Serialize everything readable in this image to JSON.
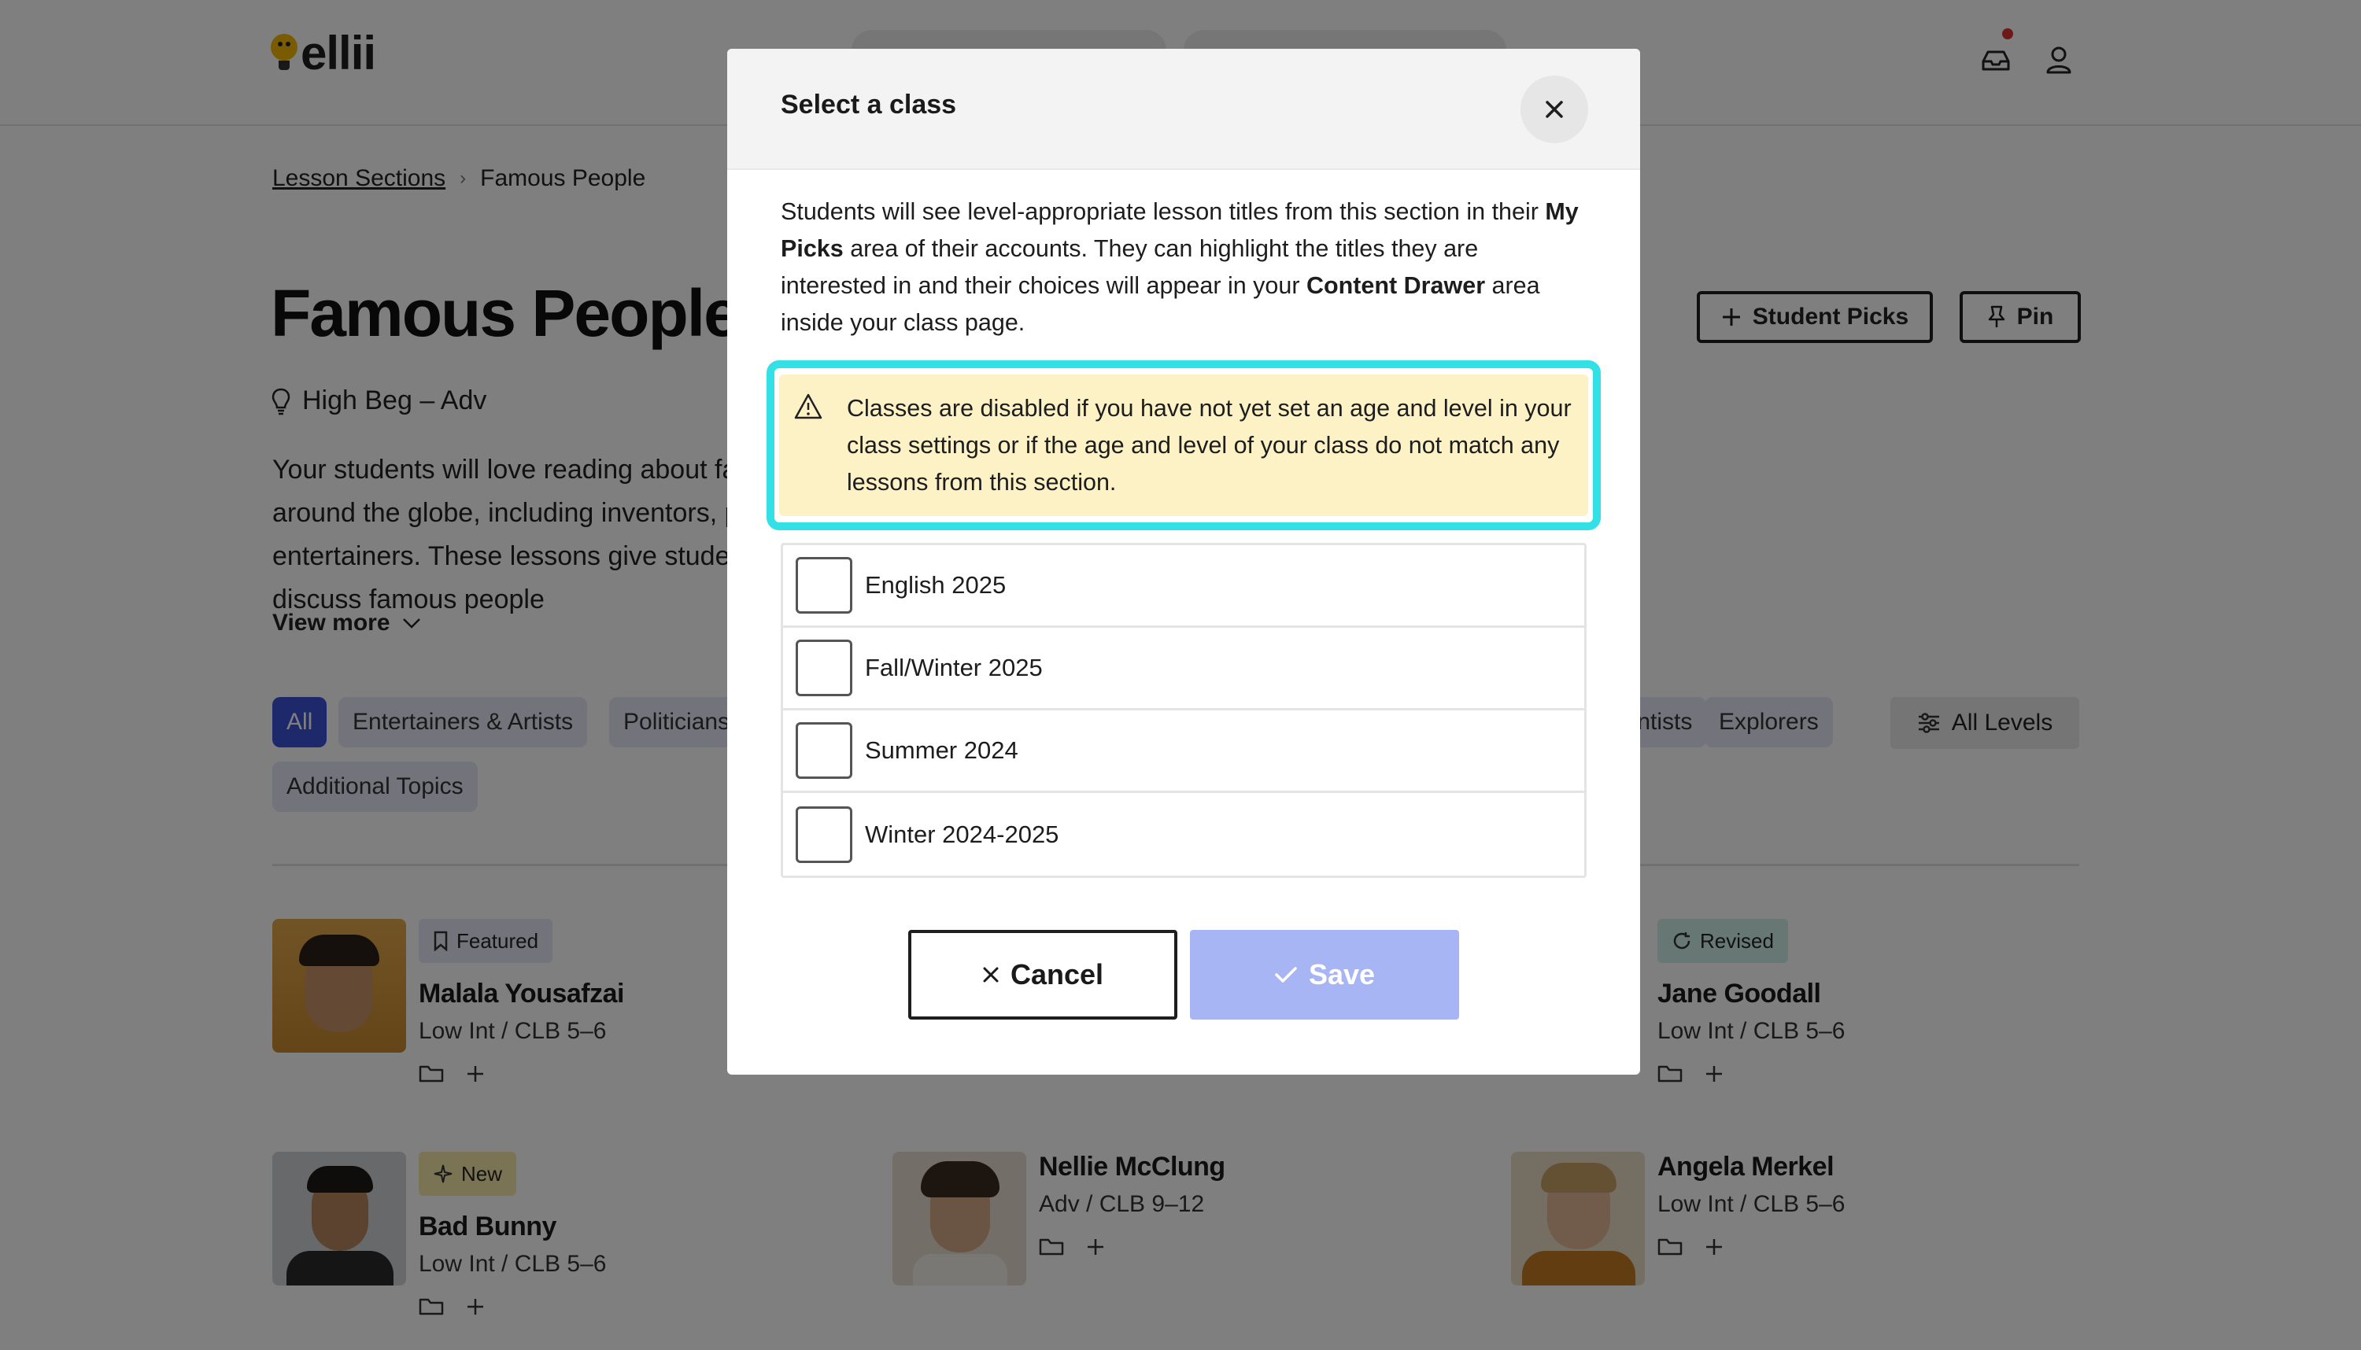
{
  "app": {
    "logo_text": "ellii"
  },
  "breadcrumb": {
    "parent": "Lesson Sections",
    "separator": "›",
    "current": "Famous People"
  },
  "section": {
    "title": "Famous People",
    "level_range": "High Beg – Adv",
    "description": "Your students will love reading about famous people from around the globe, including inventors, politicians, and entertainers. These lessons give students the opportunity to discuss famous people",
    "view_more": "View more",
    "student_picks_label": "Student Picks",
    "pin_label": "Pin",
    "all_levels_label": "All Levels"
  },
  "filters": [
    {
      "label": "All",
      "active": true
    },
    {
      "label": "Entertainers & Artists",
      "active": false
    },
    {
      "label": "Politicians",
      "active": false
    },
    {
      "label": "Scientists",
      "active": false
    },
    {
      "label": "Explorers",
      "active": false
    },
    {
      "label": "Additional Topics",
      "active": false
    }
  ],
  "lessons": [
    {
      "name": "Malala Yousafzai",
      "level": "Low Int / CLB 5–6",
      "badge": "Featured"
    },
    {
      "name": "Jane Goodall",
      "level": "Low Int / CLB 5–6",
      "badge": "Revised"
    },
    {
      "name": "Bad Bunny",
      "level": "Low Int / CLB 5–6",
      "badge": "New"
    },
    {
      "name": "Nellie McClung",
      "level": "Adv / CLB 9–12",
      "badge": ""
    },
    {
      "name": "Angela Merkel",
      "level": "Low Int / CLB 5–6",
      "badge": ""
    }
  ],
  "modal": {
    "title": "Select a class",
    "intro_1": "Students will see level-appropriate lesson titles from this section in their ",
    "intro_bold_1": "My Picks",
    "intro_2": " area of their accounts. They can highlight the titles they are interested in and their choices will appear in your ",
    "intro_bold_2": "Content Drawer",
    "intro_3": " area inside your class page.",
    "warning": "Classes are disabled if you have not yet set an age and level in your class settings or if the age and level of your class do not match any lessons from this section.",
    "classes": [
      {
        "label": "English 2025",
        "checked": false
      },
      {
        "label": "Fall/Winter 2025",
        "checked": false
      },
      {
        "label": "Summer 2024",
        "checked": false
      },
      {
        "label": "Winter 2024-2025",
        "checked": false
      }
    ],
    "cancel_label": "Cancel",
    "save_label": "Save"
  },
  "colors": {
    "accent": "#3a52d6",
    "warning_bg": "#fdf1c6",
    "highlight_ring": "#33e0e6",
    "save_disabled": "#a7b5f5"
  }
}
